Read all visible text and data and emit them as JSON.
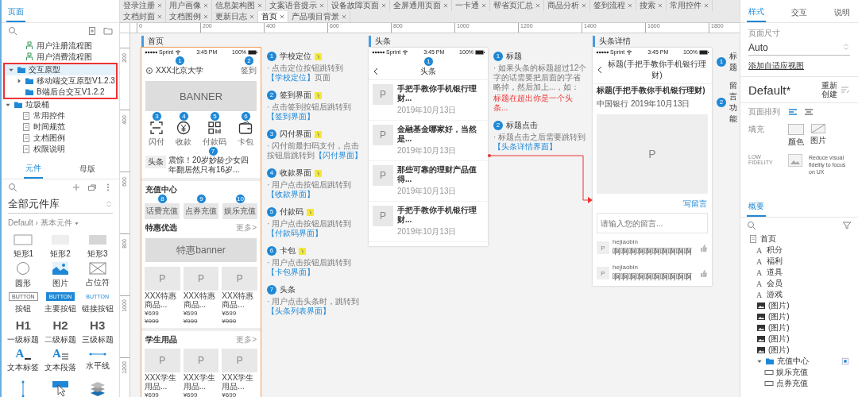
{
  "left_panel": {
    "pages_tab": {
      "label": "页面",
      "selected": true
    },
    "page_tree": [
      {
        "label": "用户注册流程图",
        "kind": "flow",
        "selected": false,
        "highlighted": false
      },
      {
        "label": "用户消费流程图",
        "kind": "flow",
        "selected": false,
        "highlighted": false
      },
      {
        "label": "交互原型",
        "kind": "folder",
        "expanded": true,
        "selected": true,
        "highlighted": true,
        "children": [
          {
            "label": "移动端交互原型V1.2.3",
            "kind": "folder",
            "expanded": false,
            "selected": false
          },
          {
            "label": "B端后台交互V1.2.2",
            "kind": "folder",
            "selected": false
          }
        ]
      },
      {
        "label": "垃圾桶",
        "kind": "folder",
        "expanded": true,
        "selected": false,
        "highlighted": false,
        "children": [
          {
            "label": "常用控件",
            "kind": "page",
            "selected": false
          },
          {
            "label": "时间规范",
            "kind": "page",
            "selected": false
          },
          {
            "label": "文档图例",
            "kind": "page",
            "selected": false
          },
          {
            "label": "权限说明",
            "kind": "page",
            "selected": false
          }
        ]
      }
    ],
    "component_tabs": [
      {
        "label": "元件",
        "selected": true
      },
      {
        "label": "母版",
        "selected": false
      }
    ],
    "library": "全部元件库",
    "breadcrumb": "Default › 基本元件",
    "widgets": [
      {
        "label": "矩形1",
        "kind": "rect-outline"
      },
      {
        "label": "矩形2",
        "kind": "rect-light"
      },
      {
        "label": "矩形3",
        "kind": "rect-gray"
      },
      {
        "label": "圆形",
        "kind": "circle"
      },
      {
        "label": "图片",
        "kind": "image"
      },
      {
        "label": "占位符",
        "kind": "placeholder"
      },
      {
        "label": "按钮",
        "kind": "button",
        "glyph": "BUTTON"
      },
      {
        "label": "主要按钮",
        "kind": "primary-button",
        "glyph": "BUTTON"
      },
      {
        "label": "链接按钮",
        "kind": "link-button",
        "glyph": "BUTTON"
      },
      {
        "label": "一级标题",
        "kind": "heading",
        "glyph": "H1"
      },
      {
        "label": "二级标题",
        "kind": "heading",
        "glyph": "H2"
      },
      {
        "label": "三级标题",
        "kind": "heading",
        "glyph": "H3"
      },
      {
        "label": "文本标签",
        "kind": "text-label",
        "glyph": "A"
      },
      {
        "label": "文本段落",
        "kind": "paragraph",
        "glyph": "A"
      },
      {
        "label": "水平线",
        "kind": "hline"
      },
      {
        "kind": "vline"
      },
      {
        "kind": "hotspot"
      },
      {
        "kind": "layers"
      }
    ]
  },
  "doc_tabs": [
    {
      "label": "登录注册",
      "selected": false
    },
    {
      "label": "用户画像",
      "selected": false
    },
    {
      "label": "信息架构图",
      "selected": false
    },
    {
      "label": "文案语音提示",
      "selected": false
    },
    {
      "label": "设备故障页面",
      "selected": false
    },
    {
      "label": "全屏通用页面",
      "selected": false
    },
    {
      "label": "一卡通",
      "selected": false
    },
    {
      "label": "帮省页汇总",
      "selected": false
    },
    {
      "label": "商品分析",
      "selected": false
    },
    {
      "label": "签到流程",
      "selected": false
    },
    {
      "label": "搜索",
      "selected": false
    },
    {
      "label": "常用控件",
      "selected": false
    },
    {
      "label": "文档封面",
      "selected": false
    },
    {
      "label": "文档图例",
      "selected": false
    },
    {
      "label": "更新日志",
      "selected": false
    },
    {
      "label": "首页",
      "selected": true
    },
    {
      "label": "产品项目背景",
      "selected": false
    }
  ],
  "ruler": {
    "x_labels": [
      "0",
      "200",
      "400",
      "600",
      "800",
      "1000",
      "1200",
      "1400",
      "1600",
      "1800"
    ],
    "y_labels": [
      "200",
      "400",
      "600",
      "800",
      "1000",
      "1200"
    ]
  },
  "home": {
    "section": "首页",
    "selected": true,
    "status": {
      "carrier": "Sprint",
      "time": "3:45 PM",
      "battery": "100%"
    },
    "location": {
      "text": "XXX北京大学",
      "pin": "1"
    },
    "checkin": {
      "text": "签到",
      "pin": "2"
    },
    "banner": "BANNER",
    "shortcuts": [
      {
        "label": "闪付",
        "kind": "scan",
        "pin": "3"
      },
      {
        "label": "收款",
        "kind": "yuan",
        "pin": "4"
      },
      {
        "label": "付款码",
        "kind": "qrcode",
        "pin": "5"
      },
      {
        "label": "卡包",
        "kind": "wallet",
        "pin": "6"
      }
    ],
    "news_tag": "头条",
    "news": {
      "text": "震惊！20岁妙龄少女四年翻居然只有16岁...",
      "pin": "7"
    },
    "recharge_title": "充值中心",
    "recharge_buttons": [
      {
        "label": "话费充值",
        "pin": "8"
      },
      {
        "label": "点券充值",
        "pin": "9"
      },
      {
        "label": "娱乐充值",
        "pin": "10"
      }
    ],
    "deals_title": "特惠优选",
    "deals_more": "更多>",
    "deals_banner": "特惠banner",
    "deals": [
      {
        "thumb": "P",
        "name": "XXX特惠商品...",
        "price": "¥699",
        "old_price": "¥999"
      },
      {
        "thumb": "P",
        "name": "XXX特惠商品...",
        "price": "¥699",
        "old_price": "¥999"
      },
      {
        "thumb": "P",
        "name": "XXX特惠商品...",
        "price": "¥699",
        "old_price": "¥999"
      }
    ],
    "supplies_title": "学生用品",
    "supplies_more": "更多>",
    "supplies": [
      {
        "thumb": "P",
        "name": "XXX学生用品...",
        "price": "¥699"
      },
      {
        "thumb": "P",
        "name": "XXX学生用品...",
        "price": "¥699"
      },
      {
        "thumb": "P",
        "name": "XXX学生用品...",
        "price": "¥699"
      }
    ]
  },
  "home_notes": [
    {
      "num": "1",
      "title": "学校定位",
      "text": "· 点击定位按钮跳转到",
      "link": "【学校定位】",
      "tail": "页面",
      "note": true
    },
    {
      "num": "2",
      "title": "签到界面",
      "text": "· 点击签到按钮后跳转到",
      "link": "【签到界面】",
      "note": true
    },
    {
      "num": "3",
      "title": "闪付界面",
      "text": "· 闪付前最扫码支付，点击按钮后跳转到",
      "link": "【闪付界面】",
      "note": true
    },
    {
      "num": "4",
      "title": "收款界面",
      "text": "· 用户点击按钮后跳转到",
      "link": "【收款界面】",
      "note": true
    },
    {
      "num": "5",
      "title": "付款码",
      "text": "· 用户点击按钮后跳转到",
      "link": "【付款码界面】",
      "note": true
    },
    {
      "num": "6",
      "title": "卡包",
      "text": "· 用户点击按钮后跳转到",
      "link": "【卡包界面】",
      "note": true
    },
    {
      "num": "7",
      "title": "头条",
      "text": "· 用户点击头条时，跳转到",
      "link": "【头条列表界面】",
      "note": false
    }
  ],
  "headlines": {
    "section": "头条",
    "selected": false,
    "status": {
      "carrier": "Sprint",
      "time": "3:45 PM",
      "battery": "100%"
    },
    "title": {
      "text": "头条",
      "pin": "1"
    },
    "items": [
      {
        "thumb": "P",
        "title": "手把手教你手机银行理财...",
        "date": "2019年10月13日"
      },
      {
        "thumb": "P",
        "title": "金融基金哪家好，当然是...",
        "date": "2019年10月13日"
      },
      {
        "thumb": "P",
        "title": "那些可靠的理财产品值得...",
        "date": "2019年10月13日"
      },
      {
        "thumb": "P",
        "title": "手把手教你手机银行理财...",
        "date": "2019年10月13日"
      }
    ]
  },
  "headlines_notes": [
    {
      "num": "1",
      "title": "标题",
      "text": "· 如果头条的标题超过12个字的话需要把后面的字省略掉，然后加上...，如：",
      "warning": "标题在超出你是一个头条..."
    },
    {
      "num": "2",
      "title": "标题点击",
      "text": "· 标题点击之后需要跳转到",
      "link": "【头条详情界面】"
    }
  ],
  "detail": {
    "section": "头条详情",
    "selected": false,
    "status": {
      "carrier": "Sprint",
      "time": "3:45 PM",
      "battery": "100%"
    },
    "title": "标题(手把手教你手机银行理财)",
    "heading": "标题(手把手教你手机银行理财)",
    "source": "中国银行",
    "date": "2019年10月13日",
    "image": "P",
    "write": "写留言",
    "placeholder": "请输入您的留言...",
    "comments": [
      {
        "avatar": "P",
        "name": "hejiaobin",
        "text": "啊啊啊啊啊啊啊啊啊啊"
      },
      {
        "avatar": "P",
        "name": "hejiaobin",
        "text": "啊啊啊啊啊啊啊啊啊啊"
      }
    ]
  },
  "detail_notes": [
    {
      "num": "1",
      "title": "标题"
    },
    {
      "num": "2",
      "title": "留言功能"
    }
  ],
  "right_panel": {
    "tabs": [
      {
        "label": "样式",
        "selected": true
      },
      {
        "label": "交互",
        "selected": false
      },
      {
        "label": "说明",
        "selected": false
      }
    ],
    "page_size_label": "页面尺寸",
    "page_size": "Auto",
    "adaptive_link": "添加自适应视图",
    "style_name": "Default*",
    "recreate": "重新创建",
    "alignment_label": "页面排列",
    "alignment": [
      {
        "kind": "left",
        "selected": true
      },
      {
        "kind": "center",
        "selected": false
      }
    ],
    "fill_label": "填充",
    "fill_options": [
      {
        "label": "颜色",
        "kind": "color"
      },
      {
        "label": "图片",
        "kind": "image"
      }
    ],
    "low_fidelity_label": "LOW FIDELITY",
    "low_fidelity_text": "Reduce visual fidelity to focus on UX",
    "outline_tab": {
      "label": "概要",
      "selected": true
    },
    "outline": [
      {
        "label": "首页",
        "kind": "page",
        "children": [
          {
            "label": "积分",
            "kind": "text",
            "glyph": "A"
          },
          {
            "label": "福利",
            "kind": "text",
            "glyph": "A"
          },
          {
            "label": "道具",
            "kind": "text",
            "glyph": "A"
          },
          {
            "label": "会员",
            "kind": "text",
            "glyph": "A"
          },
          {
            "label": "游戏",
            "kind": "text",
            "glyph": "A"
          },
          {
            "label": "(图片)",
            "kind": "image"
          },
          {
            "label": "(图片)",
            "kind": "image"
          },
          {
            "label": "(图片)",
            "kind": "image"
          },
          {
            "label": "(图片)",
            "kind": "image"
          },
          {
            "label": "(图片)",
            "kind": "image"
          },
          {
            "label": "充值中心",
            "kind": "folder",
            "expanded": true,
            "children": [
              {
                "label": "娱乐充值",
                "kind": "shape"
              },
              {
                "label": "点券充值",
                "kind": "shape"
              }
            ]
          }
        ]
      }
    ]
  }
}
